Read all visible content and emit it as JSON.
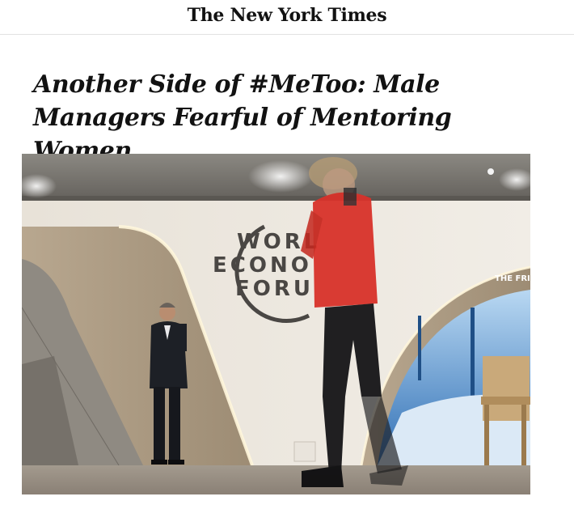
{
  "masthead": {
    "logo_text": "The New York Times"
  },
  "article": {
    "headline_line1": "Another Side of #MeToo: Male",
    "headline_line2": "Managers Fearful of Mentoring Women"
  },
  "photo": {
    "sign_line1": "WORL",
    "sign_line2": "ECONO",
    "sign_line3": "FORU",
    "sign_right": "THE FRIE"
  },
  "colors": {
    "headline": "#121212",
    "jacket": "#d8322a",
    "ceiling": "#7d7a75",
    "wall": "#ece7df",
    "panel": "#a89780"
  }
}
